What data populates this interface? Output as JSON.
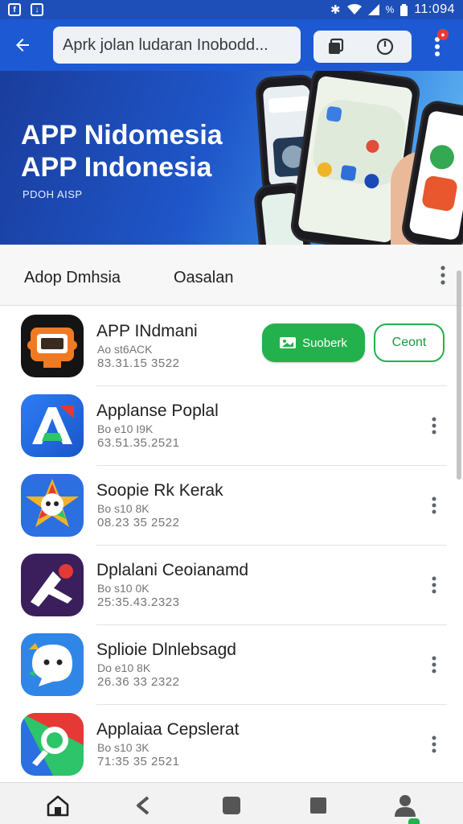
{
  "status_bar": {
    "battery": "%",
    "time": "11:094"
  },
  "search": {
    "value": "Aprk jolan ludaran Inobodd..."
  },
  "banner": {
    "title_line1": "APP Nidomesia",
    "title_line2": "APP Indonesia",
    "subtitle": "PDOH AISP"
  },
  "filters": {
    "tab1": "Adop Dmhsia",
    "tab2": "Oasalan"
  },
  "apps": [
    {
      "name": "APP INdmani",
      "meta1": "Ao st6ACK",
      "meta2": "83.31.15 3522",
      "icon": "robot-tablet-icon",
      "primary_label": "Suoberk",
      "secondary_label": "Ceont"
    },
    {
      "name": "Applanse Poplal",
      "meta1": "Bo e10 I9K",
      "meta2": "63.51.35.2521",
      "icon": "letter-a-icon"
    },
    {
      "name": "Soopie Rk Kerak",
      "meta1": "Bo s10 8K",
      "meta2": "08.23 35 2522",
      "icon": "star-face-icon"
    },
    {
      "name": "Dplalani Ceoianamd",
      "meta1": "Bo s10 0K",
      "meta2": "25:35.43.2323",
      "icon": "airplane-icon"
    },
    {
      "name": "Splioie Dlnlebsagd",
      "meta1": "Do e10 8K",
      "meta2": "26.36 33 2322",
      "icon": "chat-face-icon"
    },
    {
      "name": "Applaiaa Cepslerat",
      "meta1": "Bo s10 3K",
      "meta2": "71:35 35 2521",
      "icon": "magnifier-icon"
    }
  ],
  "colors": {
    "primary_blue": "#1e59d4",
    "accent_green": "#22b14c"
  }
}
